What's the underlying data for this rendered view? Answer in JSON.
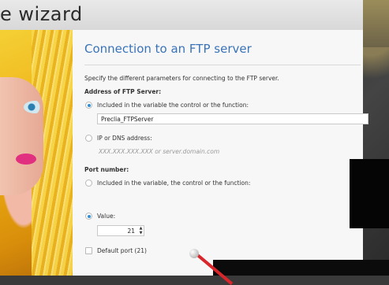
{
  "window": {
    "title": "e wizard"
  },
  "page": {
    "heading": "Connection to an FTP server",
    "description": "Specify the different parameters for connecting to the FTP server."
  },
  "address": {
    "section_label": "Address of FTP Server:",
    "option_variable_label": "Included in the variable the control or the function:",
    "variable_value": "Preclia_FTPServer",
    "option_ip_label": "IP or DNS address:",
    "ip_placeholder": "XXX.XXX.XXX.XXX or server.domain.com"
  },
  "port": {
    "section_label": "Port number:",
    "option_variable_label": "Included in the variable, the control or the function:",
    "option_value_label": "Value:",
    "value": "21",
    "default_port_label": "Default port (21)"
  },
  "colors": {
    "heading": "#3a73b7",
    "radio_selected": "#2f8fd8"
  }
}
